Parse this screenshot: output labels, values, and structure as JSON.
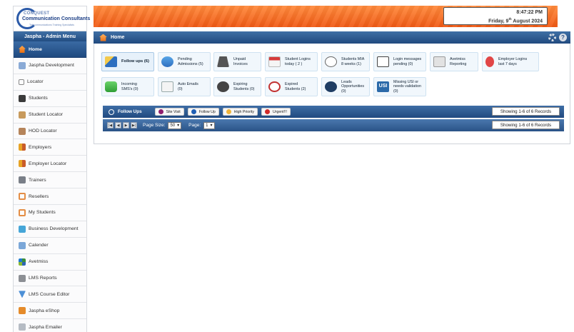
{
  "logo": {
    "line1": "CONQUEST",
    "line2": "Communication Consultants",
    "line3": "Telecommunications Training Specialists"
  },
  "sidebar": {
    "header": "Jaspha - Admin Menu",
    "items": [
      {
        "label": "Home",
        "icon": "home-icon"
      },
      {
        "label": "Jaspha Development",
        "icon": "development-icon"
      },
      {
        "label": "Locator",
        "icon": "magnifier-icon"
      },
      {
        "label": "Students",
        "icon": "students-icon"
      },
      {
        "label": "Student Locator",
        "icon": "person-icon"
      },
      {
        "label": "HOD Locator",
        "icon": "person-icon"
      },
      {
        "label": "Employers",
        "icon": "employers-icon"
      },
      {
        "label": "Employer Locator",
        "icon": "employers-icon"
      },
      {
        "label": "Trainers",
        "icon": "trainers-icon"
      },
      {
        "label": "Resellers",
        "icon": "resellers-icon"
      },
      {
        "label": "My Students",
        "icon": "my-students-icon"
      },
      {
        "label": "Business Development",
        "icon": "handshake-icon"
      },
      {
        "label": "Calender",
        "icon": "calendar-icon"
      },
      {
        "label": "Avetmiss",
        "icon": "globe-icon"
      },
      {
        "label": "LMS Reports",
        "icon": "reports-icon"
      },
      {
        "label": "LMS Course Editor",
        "icon": "course-editor-icon"
      },
      {
        "label": "Jaspha eShop",
        "icon": "shop-icon"
      },
      {
        "label": "Jaspha Emailer",
        "icon": "emailer-icon"
      }
    ]
  },
  "clock": {
    "time": "8:47:22 PM",
    "date_prefix": "Friday, 9",
    "date_suffix": "th",
    "date_rest": " August 2024"
  },
  "homebar": {
    "title": "Home",
    "help": "?"
  },
  "tiles": {
    "follow_ups": {
      "line1": "Follow ups (6)",
      "line2": ""
    },
    "pending_admissions": {
      "line1": "Pending",
      "line2": "Admissions (5)"
    },
    "unpaid_invoices": {
      "line1": "Unpaid",
      "line2": "Invoices"
    },
    "student_logins": {
      "line1": "Student Logins",
      "line2": "today ( 2 )"
    },
    "students_mia": {
      "line1": "Students MIA",
      "line2": "8 weeks (1)"
    },
    "login_messages": {
      "line1": "Login messages",
      "line2": "pending (0)"
    },
    "avetmiss_reporting": {
      "line1": "Avetmiss",
      "line2": "Reporting"
    },
    "employer_logins": {
      "line1": "Employer Logins",
      "line2": "last 7 days"
    },
    "incoming_sms": {
      "line1": "Incoming",
      "line2": "SMS's (0)"
    },
    "auto_emails": {
      "line1": "Auto Emails",
      "line2": "(0)"
    },
    "expiring_students": {
      "line1": "Expiring",
      "line2": "Students (0)"
    },
    "expired_students": {
      "line1": "Expired",
      "line2": "Students (2)"
    },
    "leads": {
      "line1": "Leads",
      "line2": "Opportunities (0)"
    },
    "missing_usi": {
      "line1": "Missing USI or",
      "line2": "needs validation (0)",
      "badge": "USI"
    }
  },
  "followups": {
    "title": "Follow Ups",
    "legend": [
      {
        "label": "Site Visit",
        "color": "#8e1e6e"
      },
      {
        "label": "Follow Up",
        "color": "#1f5fb5"
      },
      {
        "label": "High Priority",
        "color": "#f0b43a"
      },
      {
        "label": "Urgent!!!",
        "color": "#d02a2a"
      }
    ],
    "showing": "Showing 1-6 of 6 Records"
  },
  "pager": {
    "page_size_label": "Page Size:",
    "page_size_value": "50",
    "page_label": "Page:",
    "page_value": "1",
    "showing": "Showing 1-6 of 6 Records"
  },
  "colors": {
    "banner_orange": "#f26a22",
    "nav_blue": "#2c5689",
    "tile_bg": "#f1f7fc"
  }
}
